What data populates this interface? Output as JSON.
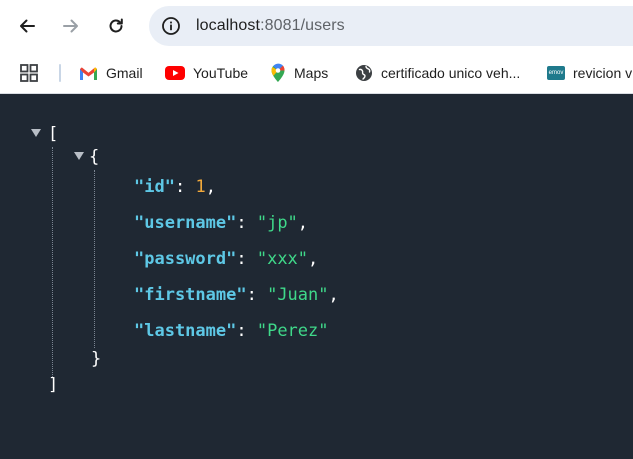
{
  "browser": {
    "url_host": "localhost",
    "url_port_path": ":8081/users"
  },
  "bookmarks": [
    {
      "label": "Gmail",
      "icon": "gmail-icon"
    },
    {
      "label": "YouTube",
      "icon": "youtube-icon"
    },
    {
      "label": "Maps",
      "icon": "maps-icon"
    },
    {
      "label": "certificado unico veh...",
      "icon": "globe-icon"
    },
    {
      "label": "revicion v",
      "icon": "emov-icon",
      "favicon_text": "emov"
    }
  ],
  "json_view": {
    "open_array": "[",
    "open_object": "{",
    "close_object": "}",
    "close_array": "]",
    "fields": [
      {
        "key": "\"id\"",
        "sep": ": ",
        "value": "1",
        "type": "number",
        "comma": ","
      },
      {
        "key": "\"username\"",
        "sep": ": ",
        "value": "\"jp\"",
        "type": "string",
        "comma": ","
      },
      {
        "key": "\"password\"",
        "sep": ": ",
        "value": "\"xxx\"",
        "type": "string",
        "comma": ","
      },
      {
        "key": "\"firstname\"",
        "sep": ": ",
        "value": "\"Juan\"",
        "type": "string",
        "comma": ","
      },
      {
        "key": "\"lastname\"",
        "sep": ": ",
        "value": "\"Perez\"",
        "type": "string",
        "comma": ""
      }
    ]
  },
  "colors": {
    "background": "#1f2833",
    "key": "#5ec8e6",
    "number": "#f2a93b",
    "string": "#3fd98a"
  }
}
